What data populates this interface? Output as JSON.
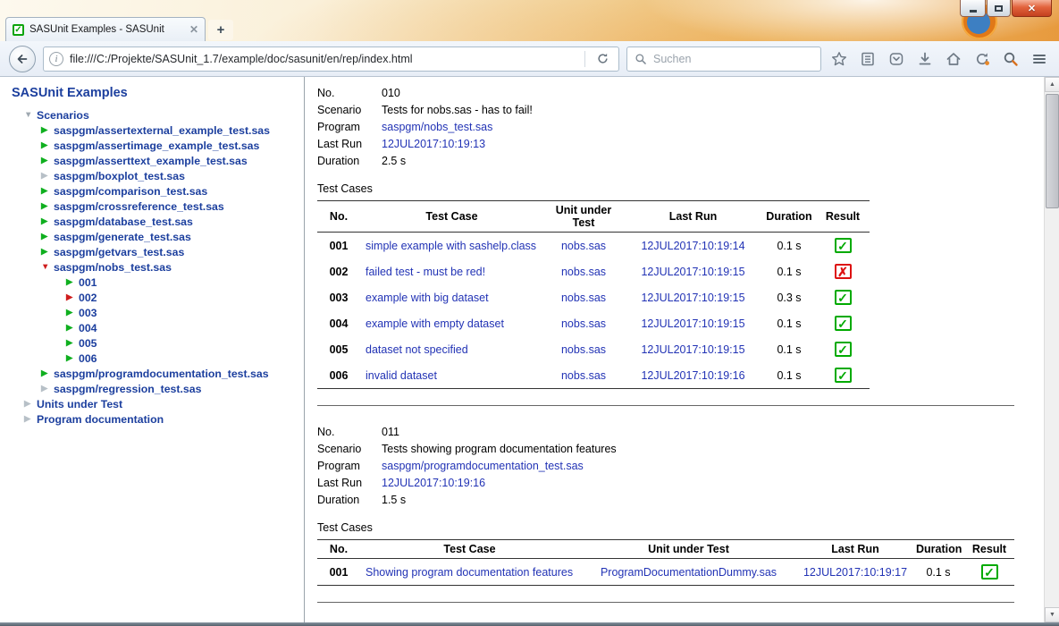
{
  "tab": {
    "title": "SASUnit Examples - SASUnit"
  },
  "toolbar": {
    "url": "file:///C:/Projekte/SASUnit_1.7/example/doc/sasunit/en/rep/index.html",
    "search_placeholder": "Suchen"
  },
  "sidebar": {
    "title": "SASUnit Examples",
    "tree": [
      {
        "label": "Scenarios",
        "level": 0,
        "marker": "expanded-gray"
      },
      {
        "label": "saspgm/assertexternal_example_test.sas",
        "level": 1,
        "marker": "green"
      },
      {
        "label": "saspgm/assertimage_example_test.sas",
        "level": 1,
        "marker": "green"
      },
      {
        "label": "saspgm/asserttext_example_test.sas",
        "level": 1,
        "marker": "green"
      },
      {
        "label": "saspgm/boxplot_test.sas",
        "level": 1,
        "marker": "gray"
      },
      {
        "label": "saspgm/comparison_test.sas",
        "level": 1,
        "marker": "green"
      },
      {
        "label": "saspgm/crossreference_test.sas",
        "level": 1,
        "marker": "green"
      },
      {
        "label": "saspgm/database_test.sas",
        "level": 1,
        "marker": "green"
      },
      {
        "label": "saspgm/generate_test.sas",
        "level": 1,
        "marker": "green"
      },
      {
        "label": "saspgm/getvars_test.sas",
        "level": 1,
        "marker": "green"
      },
      {
        "label": "saspgm/nobs_test.sas",
        "level": 1,
        "marker": "expanded-red"
      },
      {
        "label": "001",
        "level": 2,
        "marker": "green"
      },
      {
        "label": "002",
        "level": 2,
        "marker": "red"
      },
      {
        "label": "003",
        "level": 2,
        "marker": "green"
      },
      {
        "label": "004",
        "level": 2,
        "marker": "green"
      },
      {
        "label": "005",
        "level": 2,
        "marker": "green"
      },
      {
        "label": "006",
        "level": 2,
        "marker": "green"
      },
      {
        "label": "saspgm/programdocumentation_test.sas",
        "level": 1,
        "marker": "green"
      },
      {
        "label": "saspgm/regression_test.sas",
        "level": 1,
        "marker": "gray"
      },
      {
        "label": "Units under Test",
        "level": 0,
        "marker": "collapsed-gray"
      },
      {
        "label": "Program documentation",
        "level": 0,
        "marker": "collapsed-gray"
      }
    ]
  },
  "main": {
    "scenarios": [
      {
        "details": [
          {
            "label": "No.",
            "value": "010",
            "link": false
          },
          {
            "label": "Scenario",
            "value": "Tests for nobs.sas - has to fail!",
            "link": false
          },
          {
            "label": "Program",
            "value": "saspgm/nobs_test.sas",
            "link": true
          },
          {
            "label": "Last Run",
            "value": "12JUL2017:10:19:13",
            "link": true
          },
          {
            "label": "Duration",
            "value": "2.5 s",
            "link": false
          }
        ],
        "section_label": "Test Cases",
        "table": {
          "headers": [
            "No.",
            "Test Case",
            "Unit under Test",
            "Last Run",
            "Duration",
            "Result"
          ],
          "rows": [
            {
              "no": "001",
              "test_case": "simple example with sashelp.class",
              "unit": "nobs.sas",
              "last_run": "12JUL2017:10:19:14",
              "duration": "0.1 s",
              "result": "pass"
            },
            {
              "no": "002",
              "test_case": "failed test - must be red!",
              "unit": "nobs.sas",
              "last_run": "12JUL2017:10:19:15",
              "duration": "0.1 s",
              "result": "fail"
            },
            {
              "no": "003",
              "test_case": "example with big dataset",
              "unit": "nobs.sas",
              "last_run": "12JUL2017:10:19:15",
              "duration": "0.3 s",
              "result": "pass"
            },
            {
              "no": "004",
              "test_case": "example with empty dataset",
              "unit": "nobs.sas",
              "last_run": "12JUL2017:10:19:15",
              "duration": "0.1 s",
              "result": "pass"
            },
            {
              "no": "005",
              "test_case": "dataset not specified",
              "unit": "nobs.sas",
              "last_run": "12JUL2017:10:19:15",
              "duration": "0.1 s",
              "result": "pass"
            },
            {
              "no": "006",
              "test_case": "invalid dataset",
              "unit": "nobs.sas",
              "last_run": "12JUL2017:10:19:16",
              "duration": "0.1 s",
              "result": "pass"
            }
          ]
        }
      },
      {
        "details": [
          {
            "label": "No.",
            "value": "011",
            "link": false
          },
          {
            "label": "Scenario",
            "value": "Tests showing program documentation features",
            "link": false
          },
          {
            "label": "Program",
            "value": "saspgm/programdocumentation_test.sas",
            "link": true
          },
          {
            "label": "Last Run",
            "value": "12JUL2017:10:19:16",
            "link": true
          },
          {
            "label": "Duration",
            "value": "1.5 s",
            "link": false
          }
        ],
        "section_label": "Test Cases",
        "table": {
          "headers": [
            "No.",
            "Test Case",
            "Unit under Test",
            "Last Run",
            "Duration",
            "Result"
          ],
          "rows": [
            {
              "no": "001",
              "test_case": "Showing program documentation features",
              "unit": "ProgramDocumentationDummy.sas",
              "last_run": "12JUL2017:10:19:17",
              "duration": "0.1 s",
              "result": "pass"
            }
          ]
        }
      }
    ]
  },
  "colors": {
    "link": "#2233b5",
    "sidebar_link": "#1c3f9e",
    "pass": "#00aa00",
    "fail": "#dd1111"
  }
}
